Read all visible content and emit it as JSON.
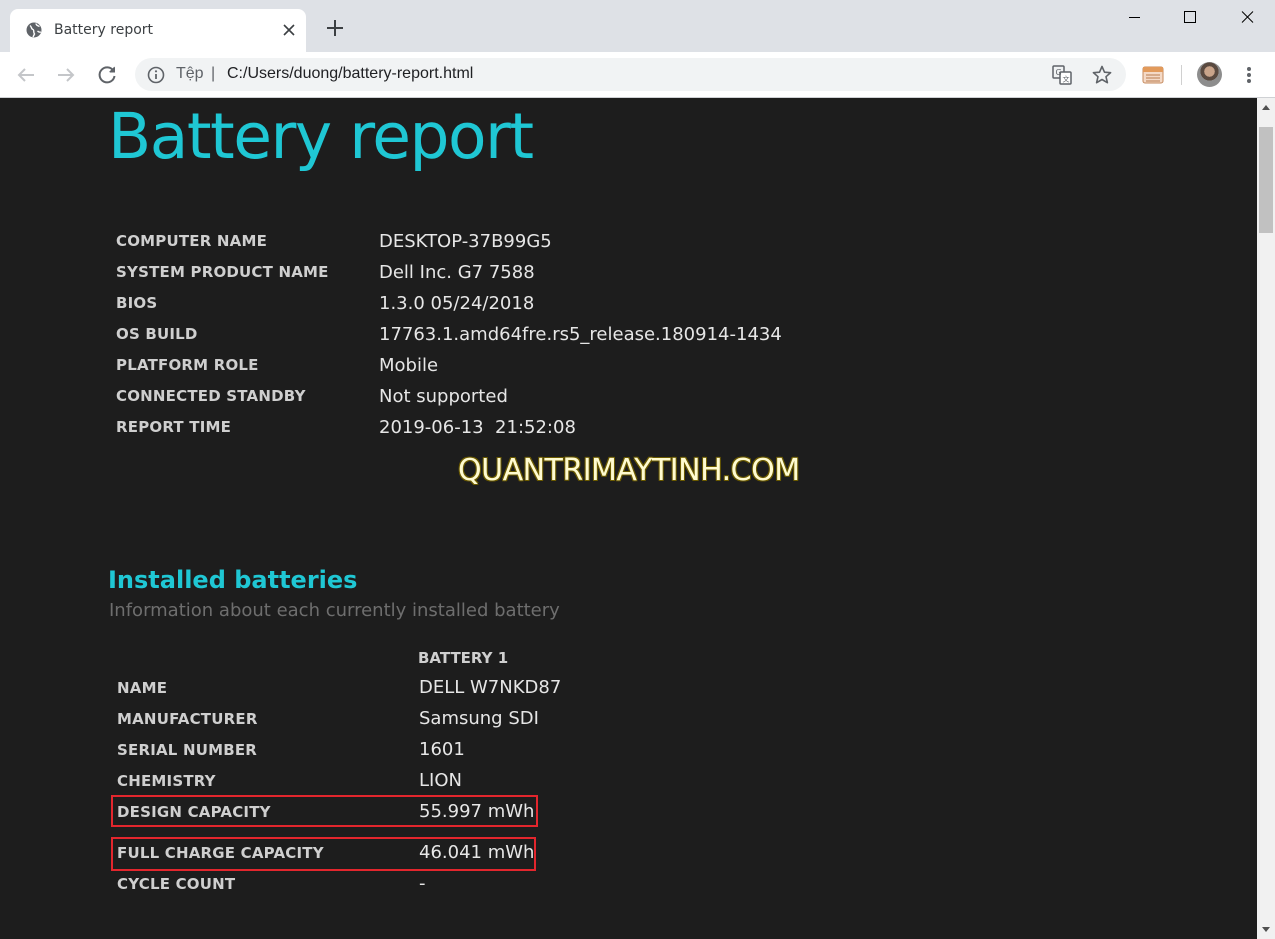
{
  "browser": {
    "tab": {
      "title": "Battery report",
      "favicon": "globe-icon"
    },
    "newtab": "plus-icon",
    "omnibox": {
      "scheme_label": "Tệp",
      "separator": "|",
      "url": "C:/Users/duong/battery-report.html"
    },
    "colors": {
      "tabstrip": "#dee1e6",
      "toolbar": "#ffffff",
      "omnibox": "#f1f3f4"
    }
  },
  "report": {
    "title": "Battery report",
    "system_info": [
      {
        "label": "COMPUTER NAME",
        "value": "DESKTOP-37B99G5"
      },
      {
        "label": "SYSTEM PRODUCT NAME",
        "value": "Dell Inc. G7 7588"
      },
      {
        "label": "BIOS",
        "value": "1.3.0 05/24/2018"
      },
      {
        "label": "OS BUILD",
        "value": "17763.1.amd64fre.rs5_release.180914-1434"
      },
      {
        "label": "PLATFORM ROLE",
        "value": "Mobile"
      },
      {
        "label": "CONNECTED STANDBY",
        "value": "Not supported"
      },
      {
        "label": "REPORT TIME",
        "value": "2019-06-13  21:52:08"
      }
    ],
    "watermark": "QUANTRIMAYTINH.COM",
    "installed_batteries": {
      "title": "Installed batteries",
      "subtitle": "Information about each currently installed battery",
      "column_header": "BATTERY 1",
      "rows": [
        {
          "label": "NAME",
          "value": "DELL W7NKD87"
        },
        {
          "label": "MANUFACTURER",
          "value": "Samsung SDI"
        },
        {
          "label": "SERIAL NUMBER",
          "value": "1601"
        },
        {
          "label": "CHEMISTRY",
          "value": "LION"
        },
        {
          "label": "DESIGN CAPACITY",
          "value": "55.997 mWh"
        },
        {
          "label": "FULL CHARGE CAPACITY",
          "value": "46.041 mWh"
        },
        {
          "label": "CYCLE COUNT",
          "value": "-"
        }
      ]
    },
    "colors": {
      "accent": "#1fc7d4",
      "background": "#1d1d1d",
      "highlight_box": "#e3262d",
      "watermark": "#fffbd0"
    }
  }
}
